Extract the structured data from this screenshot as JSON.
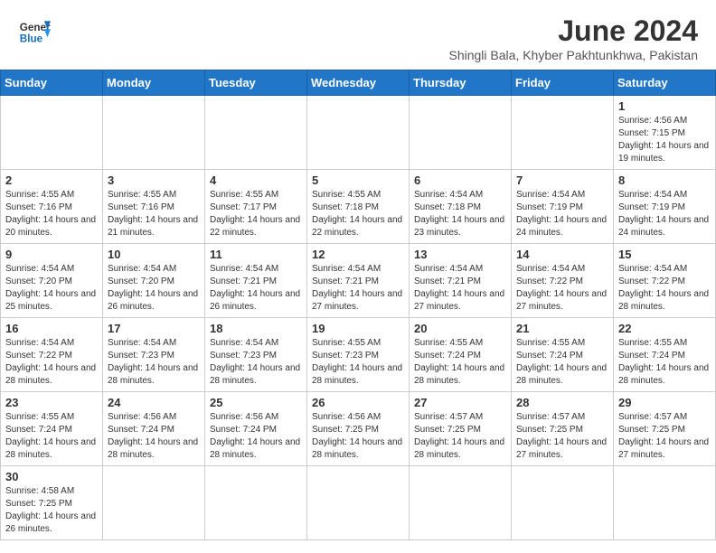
{
  "header": {
    "logo_general": "General",
    "logo_blue": "Blue",
    "title": "June 2024",
    "subtitle": "Shingli Bala, Khyber Pakhtunkhwa, Pakistan"
  },
  "days_of_week": [
    "Sunday",
    "Monday",
    "Tuesday",
    "Wednesday",
    "Thursday",
    "Friday",
    "Saturday"
  ],
  "weeks": [
    [
      {
        "day": "",
        "empty": true
      },
      {
        "day": "",
        "empty": true
      },
      {
        "day": "",
        "empty": true
      },
      {
        "day": "",
        "empty": true
      },
      {
        "day": "",
        "empty": true
      },
      {
        "day": "",
        "empty": true
      },
      {
        "day": "1",
        "sunrise": "4:56 AM",
        "sunset": "7:15 PM",
        "daylight": "14 hours and 19 minutes."
      }
    ],
    [
      {
        "day": "2",
        "sunrise": "4:55 AM",
        "sunset": "7:16 PM",
        "daylight": "14 hours and 20 minutes."
      },
      {
        "day": "3",
        "sunrise": "4:55 AM",
        "sunset": "7:16 PM",
        "daylight": "14 hours and 21 minutes."
      },
      {
        "day": "4",
        "sunrise": "4:55 AM",
        "sunset": "7:17 PM",
        "daylight": "14 hours and 22 minutes."
      },
      {
        "day": "5",
        "sunrise": "4:55 AM",
        "sunset": "7:18 PM",
        "daylight": "14 hours and 22 minutes."
      },
      {
        "day": "6",
        "sunrise": "4:54 AM",
        "sunset": "7:18 PM",
        "daylight": "14 hours and 23 minutes."
      },
      {
        "day": "7",
        "sunrise": "4:54 AM",
        "sunset": "7:19 PM",
        "daylight": "14 hours and 24 minutes."
      },
      {
        "day": "8",
        "sunrise": "4:54 AM",
        "sunset": "7:19 PM",
        "daylight": "14 hours and 24 minutes."
      }
    ],
    [
      {
        "day": "9",
        "sunrise": "4:54 AM",
        "sunset": "7:20 PM",
        "daylight": "14 hours and 25 minutes."
      },
      {
        "day": "10",
        "sunrise": "4:54 AM",
        "sunset": "7:20 PM",
        "daylight": "14 hours and 26 minutes."
      },
      {
        "day": "11",
        "sunrise": "4:54 AM",
        "sunset": "7:21 PM",
        "daylight": "14 hours and 26 minutes."
      },
      {
        "day": "12",
        "sunrise": "4:54 AM",
        "sunset": "7:21 PM",
        "daylight": "14 hours and 27 minutes."
      },
      {
        "day": "13",
        "sunrise": "4:54 AM",
        "sunset": "7:21 PM",
        "daylight": "14 hours and 27 minutes."
      },
      {
        "day": "14",
        "sunrise": "4:54 AM",
        "sunset": "7:22 PM",
        "daylight": "14 hours and 27 minutes."
      },
      {
        "day": "15",
        "sunrise": "4:54 AM",
        "sunset": "7:22 PM",
        "daylight": "14 hours and 28 minutes."
      }
    ],
    [
      {
        "day": "16",
        "sunrise": "4:54 AM",
        "sunset": "7:22 PM",
        "daylight": "14 hours and 28 minutes."
      },
      {
        "day": "17",
        "sunrise": "4:54 AM",
        "sunset": "7:23 PM",
        "daylight": "14 hours and 28 minutes."
      },
      {
        "day": "18",
        "sunrise": "4:54 AM",
        "sunset": "7:23 PM",
        "daylight": "14 hours and 28 minutes."
      },
      {
        "day": "19",
        "sunrise": "4:55 AM",
        "sunset": "7:23 PM",
        "daylight": "14 hours and 28 minutes."
      },
      {
        "day": "20",
        "sunrise": "4:55 AM",
        "sunset": "7:24 PM",
        "daylight": "14 hours and 28 minutes."
      },
      {
        "day": "21",
        "sunrise": "4:55 AM",
        "sunset": "7:24 PM",
        "daylight": "14 hours and 28 minutes."
      },
      {
        "day": "22",
        "sunrise": "4:55 AM",
        "sunset": "7:24 PM",
        "daylight": "14 hours and 28 minutes."
      }
    ],
    [
      {
        "day": "23",
        "sunrise": "4:55 AM",
        "sunset": "7:24 PM",
        "daylight": "14 hours and 28 minutes."
      },
      {
        "day": "24",
        "sunrise": "4:56 AM",
        "sunset": "7:24 PM",
        "daylight": "14 hours and 28 minutes."
      },
      {
        "day": "25",
        "sunrise": "4:56 AM",
        "sunset": "7:24 PM",
        "daylight": "14 hours and 28 minutes."
      },
      {
        "day": "26",
        "sunrise": "4:56 AM",
        "sunset": "7:25 PM",
        "daylight": "14 hours and 28 minutes."
      },
      {
        "day": "27",
        "sunrise": "4:57 AM",
        "sunset": "7:25 PM",
        "daylight": "14 hours and 28 minutes."
      },
      {
        "day": "28",
        "sunrise": "4:57 AM",
        "sunset": "7:25 PM",
        "daylight": "14 hours and 27 minutes."
      },
      {
        "day": "29",
        "sunrise": "4:57 AM",
        "sunset": "7:25 PM",
        "daylight": "14 hours and 27 minutes."
      }
    ],
    [
      {
        "day": "30",
        "sunrise": "4:58 AM",
        "sunset": "7:25 PM",
        "daylight": "14 hours and 26 minutes."
      },
      {
        "day": "",
        "empty": true
      },
      {
        "day": "",
        "empty": true
      },
      {
        "day": "",
        "empty": true
      },
      {
        "day": "",
        "empty": true
      },
      {
        "day": "",
        "empty": true
      },
      {
        "day": "",
        "empty": true
      }
    ]
  ]
}
